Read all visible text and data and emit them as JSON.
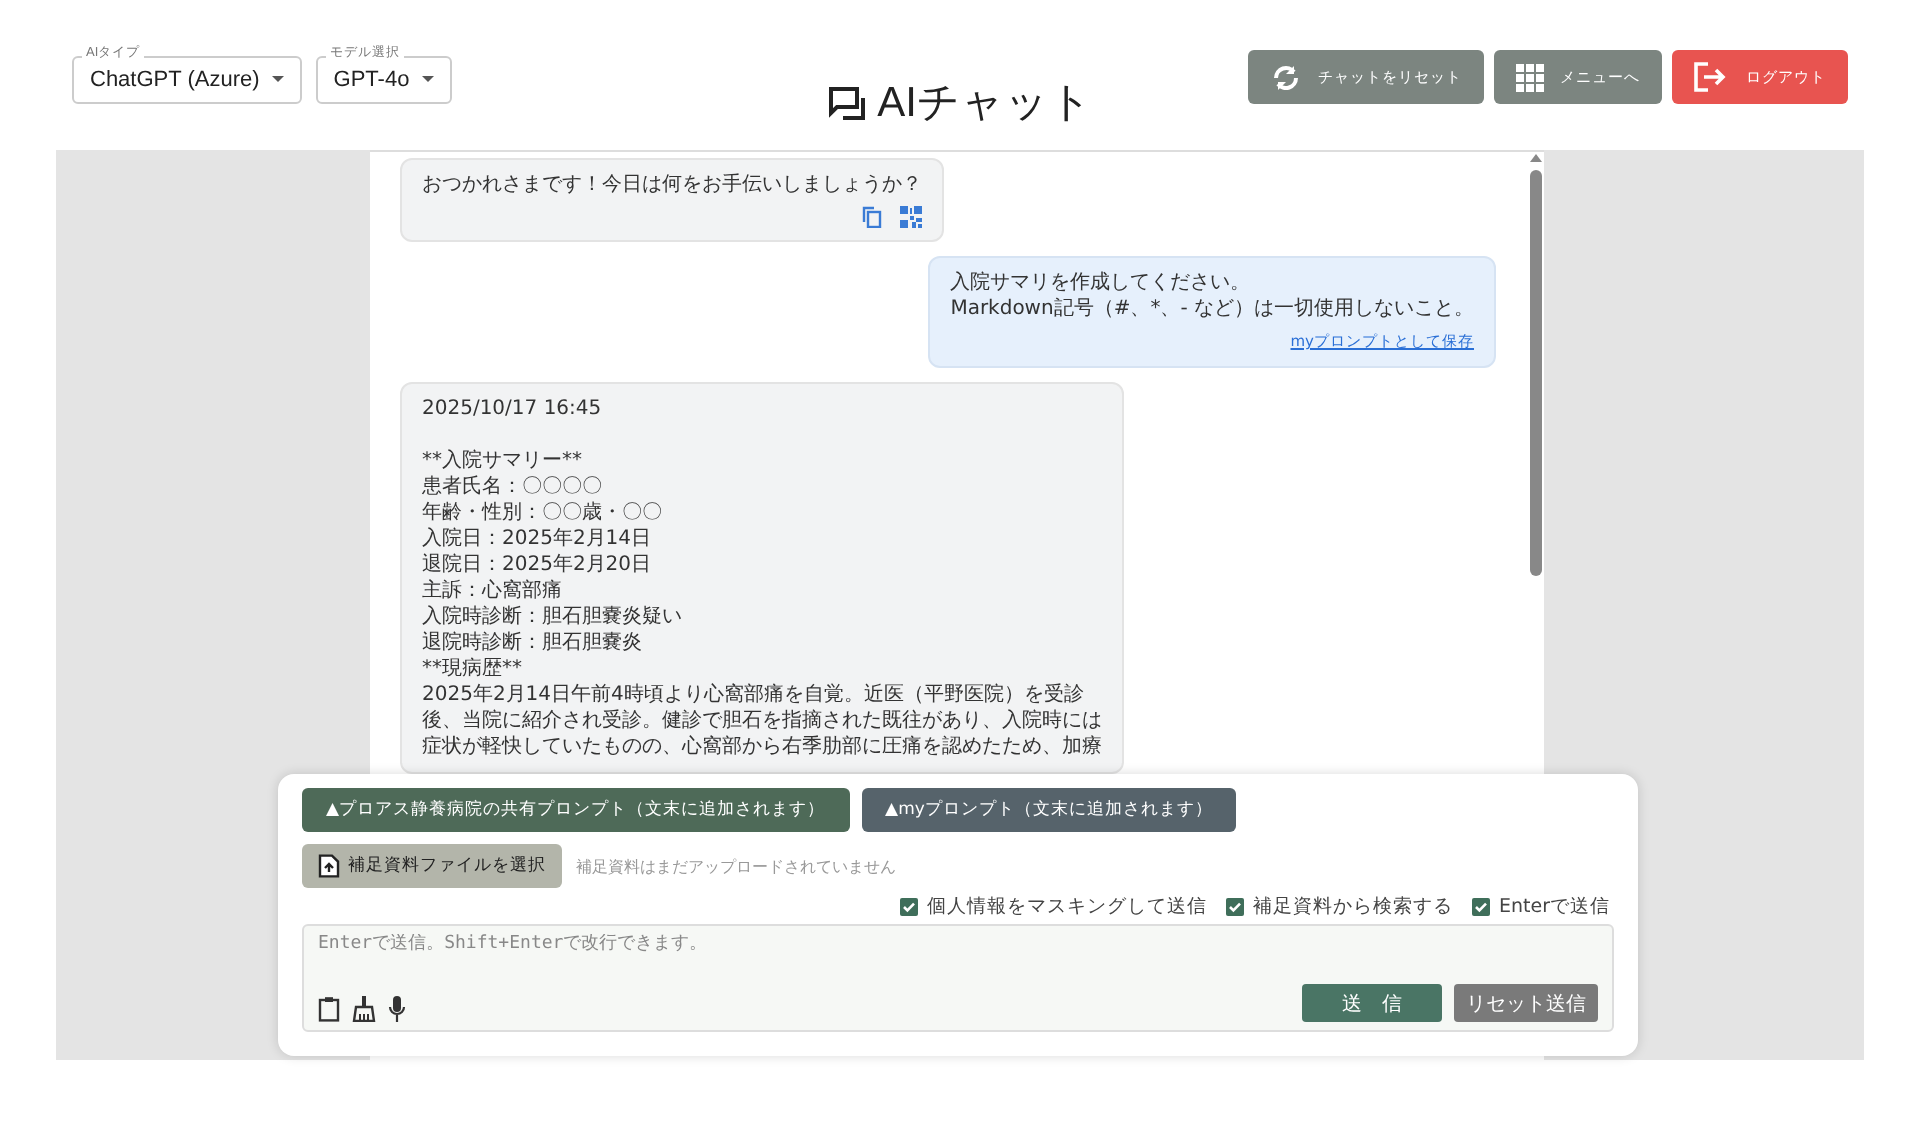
{
  "header": {
    "selects": [
      {
        "label": "AIタイプ",
        "value": "ChatGPT (Azure)"
      },
      {
        "label": "モデル選択",
        "value": "GPT-4o"
      }
    ],
    "title": "AIチャット",
    "buttons": [
      {
        "kind": "reset",
        "label": "チャットをリセット"
      },
      {
        "kind": "menu",
        "label": "メニューへ"
      },
      {
        "kind": "logout",
        "label": "ログアウト"
      }
    ]
  },
  "messages": [
    {
      "kind": "assistant",
      "lines": [
        "おつかれさまです！今日は何をお手伝いしましょうか？"
      ]
    },
    {
      "kind": "user",
      "lines": [
        "入院サマリを作成してください。",
        "Markdown記号（#、*、- など）は一切使用しないこと。"
      ],
      "link": "myプロンプトとして保存"
    },
    {
      "kind": "assistant",
      "timestamp": "2025/10/17 16:45",
      "lines": [
        "**入院サマリー**",
        "患者氏名：〇〇〇〇",
        "年齢・性別：〇〇歳・〇〇",
        "入院日：2025年2月14日",
        "退院日：2025年2月20日",
        "主訴：心窩部痛",
        "入院時診断：胆石胆嚢炎疑い",
        "退院時診断：胆石胆嚢炎",
        "**現病歴**",
        "2025年2月14日午前4時頃より心窩部痛を自覚。近医（平野医院）を受診",
        "後、当院に紹介され受診。健診で胆石を指摘された既往があり、入院時には",
        "症状が軽快していたものの、心窩部から右季肋部に圧痛を認めたため、加療"
      ]
    }
  ],
  "composer": {
    "prompt_buttons": [
      {
        "kind": "shared",
        "label": "▲プロアス静養病院の共有プロンプト（文末に追加されます）"
      },
      {
        "kind": "my",
        "label": "▲myプロンプト（文末に追加されます）"
      }
    ],
    "file_button": "補足資料ファイルを選択",
    "file_status": "補足資料はまだアップロードされていません",
    "options": [
      {
        "label": "個人情報をマスキングして送信",
        "checked": true
      },
      {
        "label": "補足資料から検索する",
        "checked": true
      },
      {
        "label": "Enterで送信",
        "checked": true
      }
    ],
    "placeholder": "Enterで送信。Shift+Enterで改行できます。",
    "send": "送　信",
    "reset_send": "リセット送信"
  }
}
